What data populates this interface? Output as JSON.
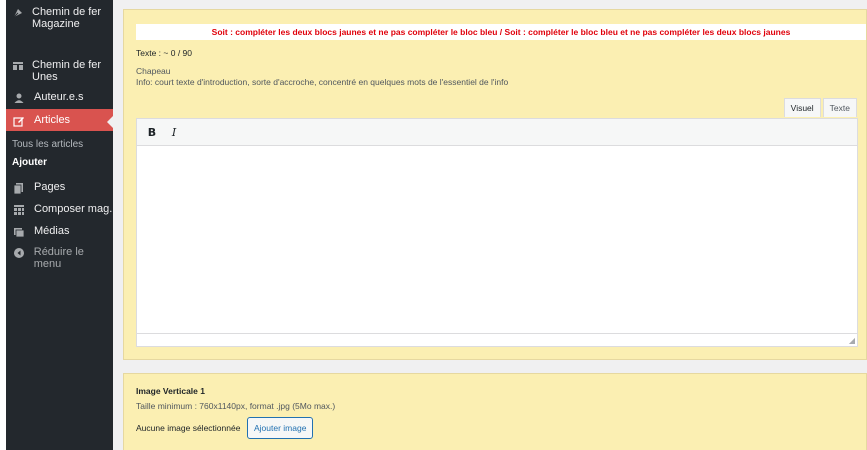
{
  "sidebar": {
    "items": [
      {
        "icon": "feather-icon",
        "label": "Chemin de fer Magazine"
      },
      {
        "icon": "columns-icon",
        "label": "Chemin de fer Unes"
      },
      {
        "icon": "user-icon",
        "label": "Auteur.e.s"
      },
      {
        "icon": "edit-icon",
        "label": "Articles"
      }
    ],
    "submenu": [
      {
        "label": "Tous les articles"
      },
      {
        "label": "Ajouter"
      }
    ],
    "items2": [
      {
        "icon": "pages-icon",
        "label": "Pages"
      },
      {
        "icon": "grid-icon",
        "label": "Composer mag."
      },
      {
        "icon": "media-icon",
        "label": "Médias"
      }
    ],
    "collapse": {
      "icon": "collapse-icon",
      "label": "Réduire le menu"
    },
    "active_color": "#d9534f"
  },
  "box1": {
    "warning": "Soit : compléter les deux blocs jaunes et ne pas compléter le bloc bleu / Soit : compléter le bloc bleu et ne pas compléter les deux blocs jaunes",
    "counter": "Texte : ~ 0 / 90",
    "field_label": "Chapeau",
    "field_help": "Info: court texte d'introduction, sorte d'accroche, concentré en quelques mots de l'essentiel de l'info",
    "tabs": [
      "Visuel",
      "Texte"
    ],
    "toolbar": {
      "bold": "B",
      "italic": "I"
    }
  },
  "box2": {
    "title": "Image Verticale 1",
    "help": "Taille minimum : 760x1140px, format .jpg (5Mo max.)",
    "no_image": "Aucune image sélectionnée",
    "add_button": "Ajouter image"
  }
}
